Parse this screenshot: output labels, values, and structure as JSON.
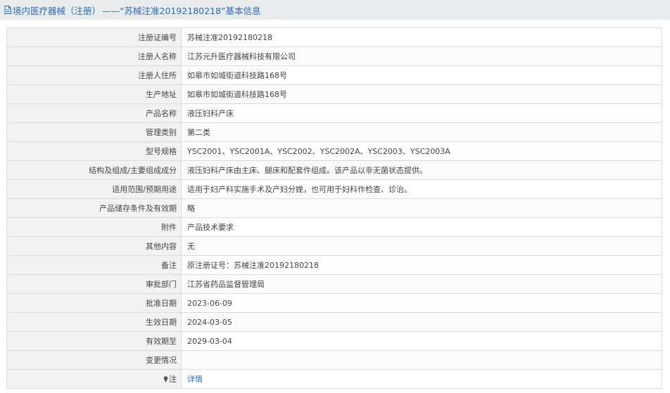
{
  "header": {
    "prefix": "境内医疗器械（注册）",
    "rest": "——“苏械注准20192180218”基本信息"
  },
  "rows": [
    {
      "label": "注册证编号",
      "value": "苏械注准20192180218"
    },
    {
      "label": "注册人名称",
      "value": "江苏元升医疗器械科技有限公司"
    },
    {
      "label": "注册人住所",
      "value": "如皋市如城街道科技路168号"
    },
    {
      "label": "生产地址",
      "value": "如皋市如城街道科技路168号"
    },
    {
      "label": "产品名称",
      "value": "液压妇科产床"
    },
    {
      "label": "管理类别",
      "value": "第二类"
    },
    {
      "label": "型号规格",
      "value": "YSC2001、YSC2001A、YSC2002、YSC2002A、YSC2003、YSC2003A"
    },
    {
      "label": "结构及组成/主要组成成分",
      "value": "液压妇科产床由主床、腿床和配套件组成。该产品以非无菌状态提供。"
    },
    {
      "label": "适用范围/预期用途",
      "value": "适用于妇产科实施手术及产妇分娩，也可用于妇科作检查、诊治。"
    },
    {
      "label": "产品储存条件及有效期",
      "value": "略"
    },
    {
      "label": "附件",
      "value": "产品技术要求"
    },
    {
      "label": "其他内容",
      "value": "无"
    },
    {
      "label": "备注",
      "value": "原注册证号：苏械注准20192180218"
    },
    {
      "label": "审批部门",
      "value": "江苏省药品监督管理局"
    },
    {
      "label": "批准日期",
      "value": "2023-06-09"
    },
    {
      "label": "生效日期",
      "value": "2024-03-05"
    },
    {
      "label": "有效期至",
      "value": "2029-03-04"
    },
    {
      "label": "变更情况",
      "value": ""
    }
  ],
  "note_row": {
    "label": "注",
    "link": "详情"
  },
  "icons": {
    "header": "document-icon",
    "note": "pin-icon"
  }
}
